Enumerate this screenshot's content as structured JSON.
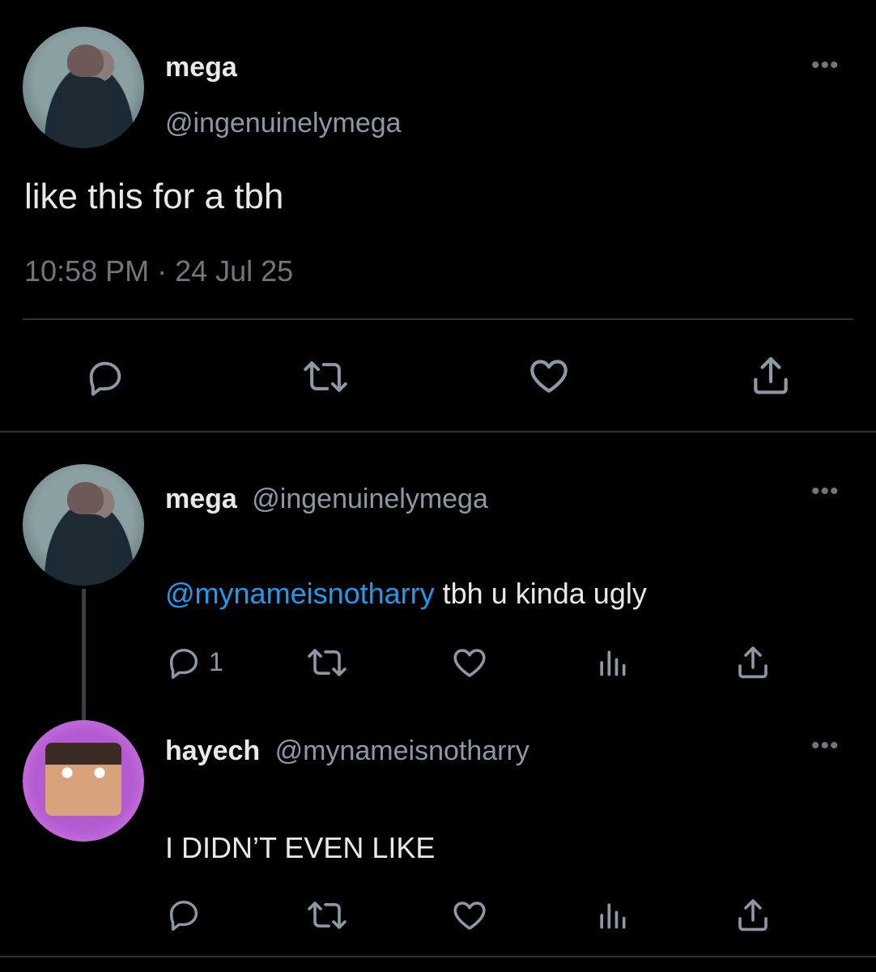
{
  "main_tweet": {
    "name": "mega",
    "handle": "@ingenuinelymega",
    "text": "like this for a tbh",
    "timestamp": "10:58 PM · 24 Jul 25",
    "more": "•••"
  },
  "reply1": {
    "name": "mega",
    "handle": "@ingenuinelymega",
    "mention": "@mynameisnotharry",
    "text": " tbh u kinda ugly",
    "reply_count": "1",
    "more": "•••"
  },
  "reply2": {
    "name": "hayech",
    "handle": "@mynameisnotharry",
    "text": "I DIDN’T EVEN LIKE",
    "more": "•••"
  },
  "icons": [
    "reply-icon",
    "retweet-icon",
    "like-icon",
    "views-icon",
    "share-icon",
    "more-icon"
  ],
  "colors": {
    "background": "#000000",
    "text": "#e7e9ea",
    "muted": "#71767b",
    "mention": "#1d9bf0"
  }
}
